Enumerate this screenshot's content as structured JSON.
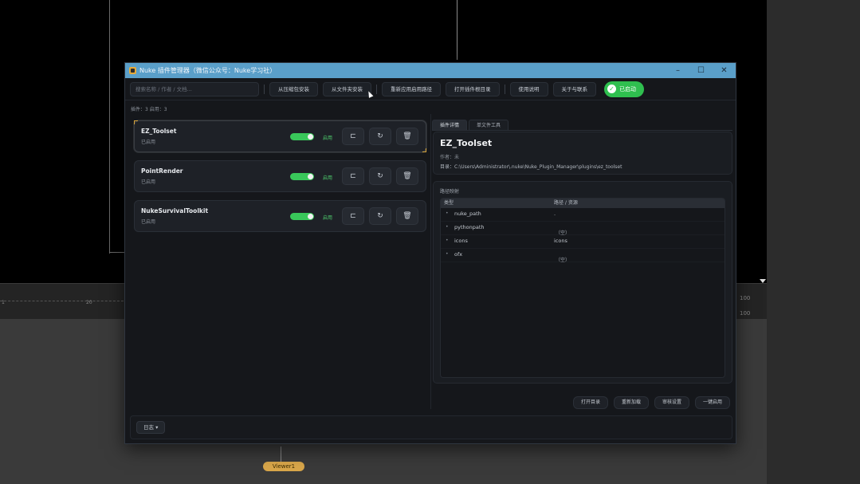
{
  "window": {
    "title": "Nuke 插件管理器（微信公众号：Nuke学习社）",
    "controls": {
      "minimize": "–",
      "maximize": "☐",
      "close": "✕"
    }
  },
  "toolbar": {
    "search_placeholder": "搜索名称 / 作者 / 文档...",
    "buttons": [
      "从压缩包安装",
      "从文件夹安装",
      "重新应用启用路径",
      "打开插件根目录",
      "使用说明",
      "关于与联系"
    ],
    "enabled_label": "已启动"
  },
  "counts": "插件：3    启用：3",
  "plugins": [
    {
      "name": "EZ_Toolset",
      "status": "已启用",
      "toggle_label": "启用",
      "selected": true
    },
    {
      "name": "PointRender",
      "status": "已启用",
      "toggle_label": "启用",
      "selected": false
    },
    {
      "name": "NukeSurvivalToolkit",
      "status": "已启用",
      "toggle_label": "启用",
      "selected": false
    }
  ],
  "plugin_actions": {
    "open_folder_icon": "⊏",
    "reload_icon": "↻",
    "delete_icon": "🗑"
  },
  "tabs": [
    "插件详情",
    "单文件工具"
  ],
  "detail": {
    "title": "EZ_Toolset",
    "author": "作者：未",
    "dir": "目录：C:\\Users\\Administrator\\.nuke\\Nuke_Plugin_Manager\\plugins\\ez_toolset"
  },
  "paths": {
    "title": "路径映射",
    "headers": [
      "类型",
      "路径 / 资源"
    ],
    "rows": [
      {
        "name": "nuke_path",
        "val1": ".",
        "val2": ""
      },
      {
        "name": "pythonpath",
        "val1": "",
        "val2": "（空）"
      },
      {
        "name": "icons",
        "val1": "icons",
        "val2": ""
      },
      {
        "name": "ofx",
        "val1": "",
        "val2": "（空）"
      }
    ]
  },
  "bottom_actions": [
    "打开目录",
    "重新加载",
    "审核设置",
    "一键启用"
  ],
  "log_button": "日志 ▾",
  "background": {
    "viewer_node": "Viewer1",
    "tl_labels": [
      "1",
      "20"
    ],
    "tl_right": [
      "100",
      "100"
    ]
  }
}
